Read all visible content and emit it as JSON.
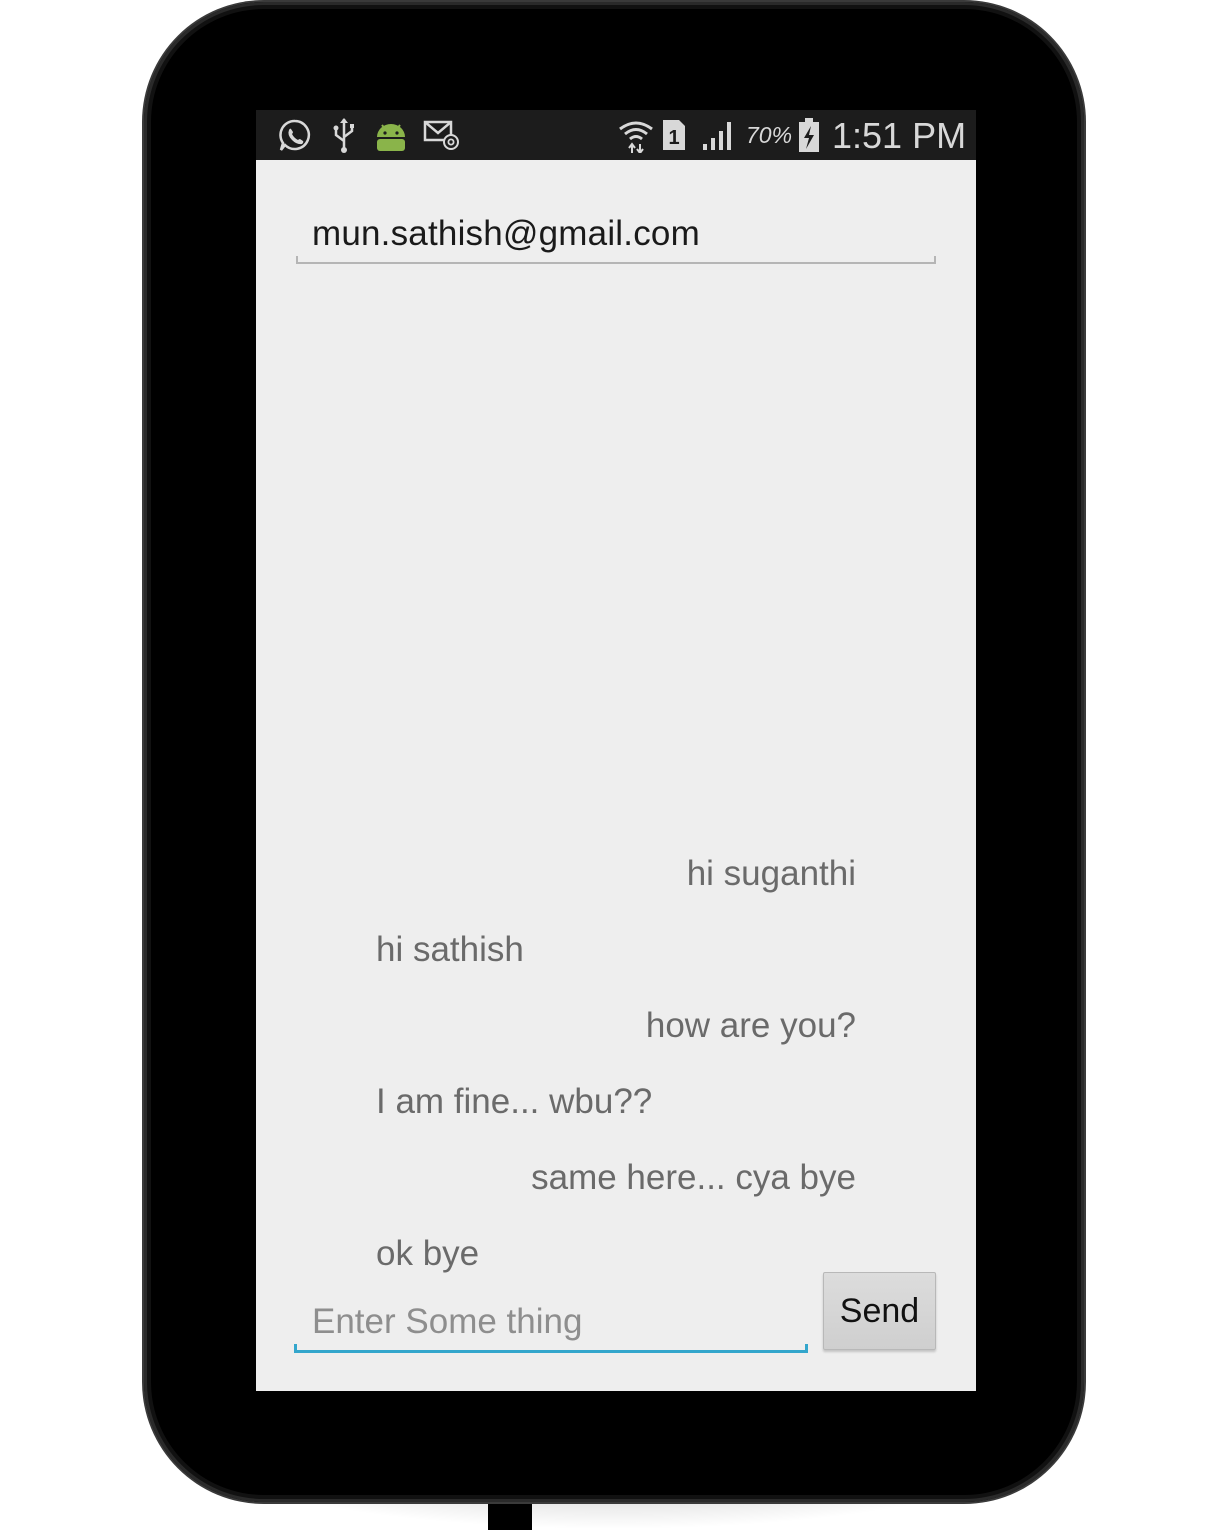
{
  "status_bar": {
    "battery_percent": "70%",
    "sim_slot": "1",
    "time": "1:51 PM",
    "left_icons": [
      "whatsapp-icon",
      "usb-icon",
      "android-icon",
      "email-icon"
    ],
    "right_icons": [
      "wifi-icon",
      "sim-icon",
      "signal-icon",
      "battery-charging-icon"
    ],
    "background_color": "#1c1c1c",
    "text_color": "#d8d8d8"
  },
  "chat": {
    "recipient_email": "mun.sathish@gmail.com",
    "messages": [
      {
        "text": "hi suganthi",
        "align": "right"
      },
      {
        "text": "hi sathish",
        "align": "left"
      },
      {
        "text": "how are you?",
        "align": "right"
      },
      {
        "text": "I am fine... wbu??",
        "align": "left"
      },
      {
        "text": "same here... cya bye",
        "align": "right"
      },
      {
        "text": "ok bye",
        "align": "left"
      }
    ]
  },
  "compose": {
    "placeholder": "Enter Some thing",
    "value": "",
    "send_label": "Send",
    "accent_color": "#33a6cc"
  },
  "colors": {
    "screen_background": "#eeeeee",
    "message_text": "#6a6a6a",
    "device_frame": "#000000"
  }
}
